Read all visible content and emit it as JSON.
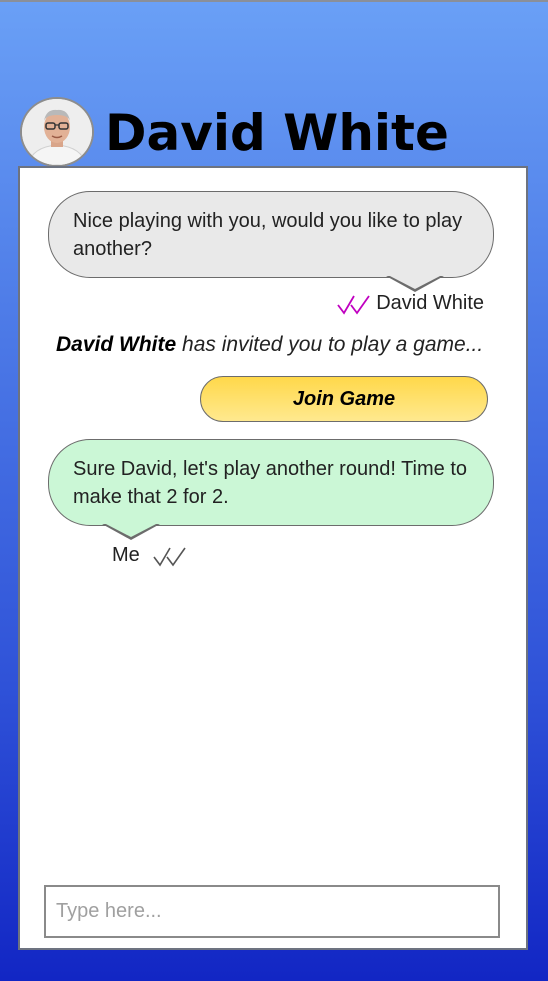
{
  "header": {
    "contact_name": "David White",
    "avatar_icon": "person-avatar"
  },
  "messages": [
    {
      "direction": "incoming",
      "text": "Nice playing with you, would you like to play another?",
      "sender": "David White",
      "status_icon": "double-check-icon",
      "status_color": "#c000c0"
    },
    {
      "direction": "outgoing",
      "text": "Sure David, let's play another round! Time to make that 2 for 2.",
      "sender": "Me",
      "status_icon": "double-check-icon",
      "status_color": "#555555"
    }
  ],
  "invite": {
    "sender": "David White",
    "text": "has invited you to play a game...",
    "button_label": "Join Game"
  },
  "composer": {
    "placeholder": "Type here...",
    "value": ""
  },
  "colors": {
    "incoming_bubble": "#e9e9e9",
    "outgoing_bubble": "#cbf7d6",
    "join_button": "#ffe06a"
  }
}
